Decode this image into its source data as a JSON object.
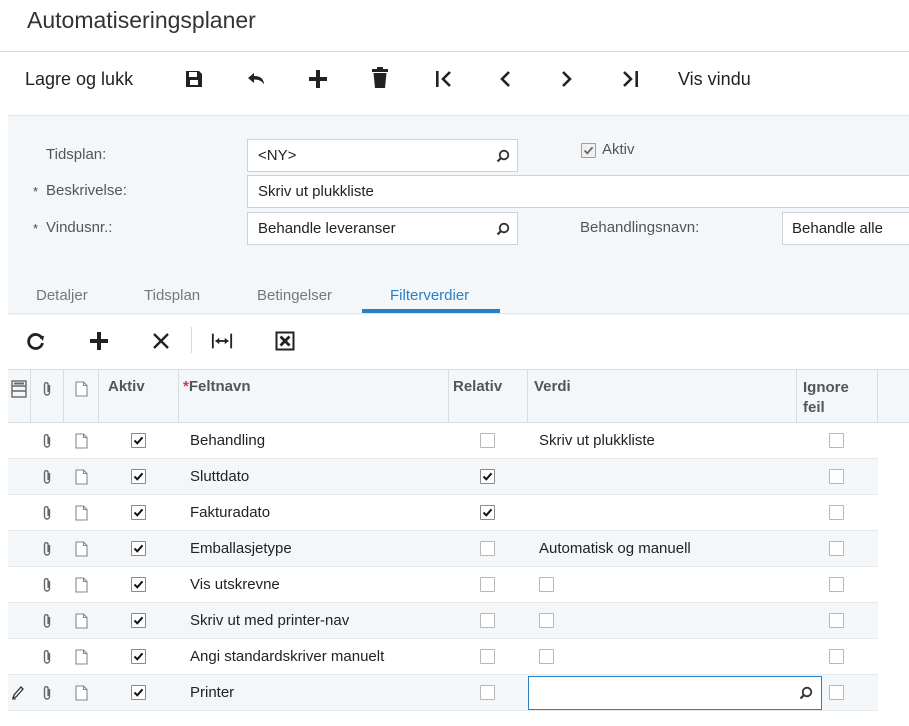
{
  "page": {
    "title": "Automatiseringsplaner"
  },
  "toolbar": {
    "save_close_label": "Lagre og lukk",
    "show_window_label": "Vis vindu",
    "icons": [
      "save-icon",
      "undo-icon",
      "add-icon",
      "delete-icon",
      "first-icon",
      "previous-icon",
      "next-icon",
      "last-icon"
    ]
  },
  "form": {
    "schedule_label": "Tidsplan:",
    "schedule_value": "<NY>",
    "active_label": "Aktiv",
    "active_checked": true,
    "description_required": "*",
    "description_label": "Beskrivelse:",
    "description_value": "Skriv ut plukkliste",
    "screen_required": "*",
    "screen_label": "Vindusnr.:",
    "screen_value": "Behandle leveranser",
    "action_label": "Behandlingsnavn:",
    "action_value": "Behandle alle"
  },
  "tabs": [
    {
      "label": "Detaljer",
      "active": false
    },
    {
      "label": "Tidsplan",
      "active": false
    },
    {
      "label": "Betingelser",
      "active": false
    },
    {
      "label": "Filterverdier",
      "active": true
    }
  ],
  "grid_toolbar": {
    "icons": [
      "refresh-icon",
      "add-icon",
      "delete-icon",
      "fit-columns-icon",
      "export-excel-icon"
    ]
  },
  "grid": {
    "columns": {
      "active": "Aktiv",
      "field_required": "*",
      "field_name": "Feltnavn",
      "relative": "Relativ",
      "value": "Verdi",
      "ignore_error": "Ignore feil"
    },
    "rows": [
      {
        "active": true,
        "field": "Behandling",
        "relative": false,
        "value": "Skriv ut plukkliste",
        "value_type": "text",
        "ignore": false
      },
      {
        "active": true,
        "field": "Sluttdato",
        "relative": true,
        "value": "",
        "value_type": "text",
        "ignore": false
      },
      {
        "active": true,
        "field": "Fakturadato",
        "relative": true,
        "value": "",
        "value_type": "text",
        "ignore": false
      },
      {
        "active": true,
        "field": "Emballasjetype",
        "relative": false,
        "value": "Automatisk og manuell",
        "value_type": "text",
        "ignore": false
      },
      {
        "active": true,
        "field": "Vis utskrevne",
        "relative": false,
        "value": "",
        "value_type": "checkbox",
        "ignore": false
      },
      {
        "active": true,
        "field": "Skriv ut med printer-nav",
        "relative": false,
        "value": "",
        "value_type": "checkbox",
        "ignore": false
      },
      {
        "active": true,
        "field": "Angi standardskriver manuelt",
        "relative": false,
        "value": "",
        "value_type": "checkbox",
        "ignore": false
      },
      {
        "active": true,
        "field": "Printer",
        "relative": false,
        "value": "",
        "value_type": "lookup",
        "ignore": false,
        "editing": true
      }
    ]
  },
  "colors": {
    "accent": "#2b7fc2",
    "header_bg": "#f4f7f9",
    "required": "#d9363e"
  }
}
